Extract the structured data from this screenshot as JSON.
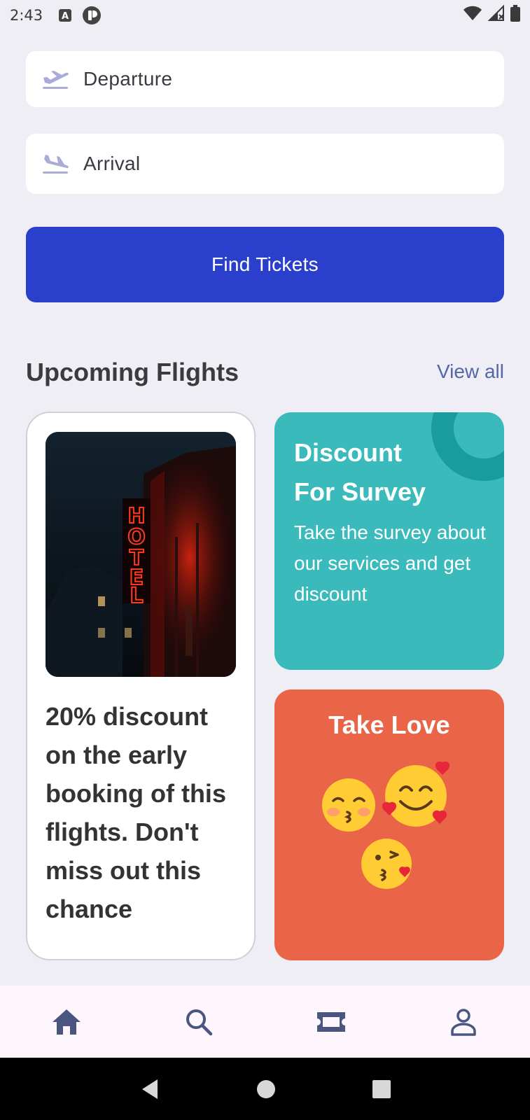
{
  "status_bar": {
    "time": "2:43"
  },
  "form": {
    "departure_label": "Departure",
    "arrival_label": "Arrival",
    "find_button": "Find Tickets"
  },
  "upcoming": {
    "title": "Upcoming Flights",
    "view_all": "View all"
  },
  "cards": {
    "promo": {
      "image_alt": "HOTEL neon sign",
      "sign_text": "HOTEL",
      "description": "20% discount on the early booking of this flights. Don't miss out this chance"
    },
    "survey": {
      "title_line1": "Discount",
      "title_line2": "For Survey",
      "body": "Take the survey about our services and get discount"
    },
    "love": {
      "title": "Take Love"
    }
  },
  "bottom_nav": {
    "items": [
      "home-icon",
      "search-icon",
      "ticket-icon",
      "profile-icon"
    ],
    "accent": "#4a5580"
  },
  "colors": {
    "primary": "#2b3fcd",
    "survey_card": "#3bbabc",
    "love_card": "#ea6547",
    "background": "#eeeef4"
  }
}
